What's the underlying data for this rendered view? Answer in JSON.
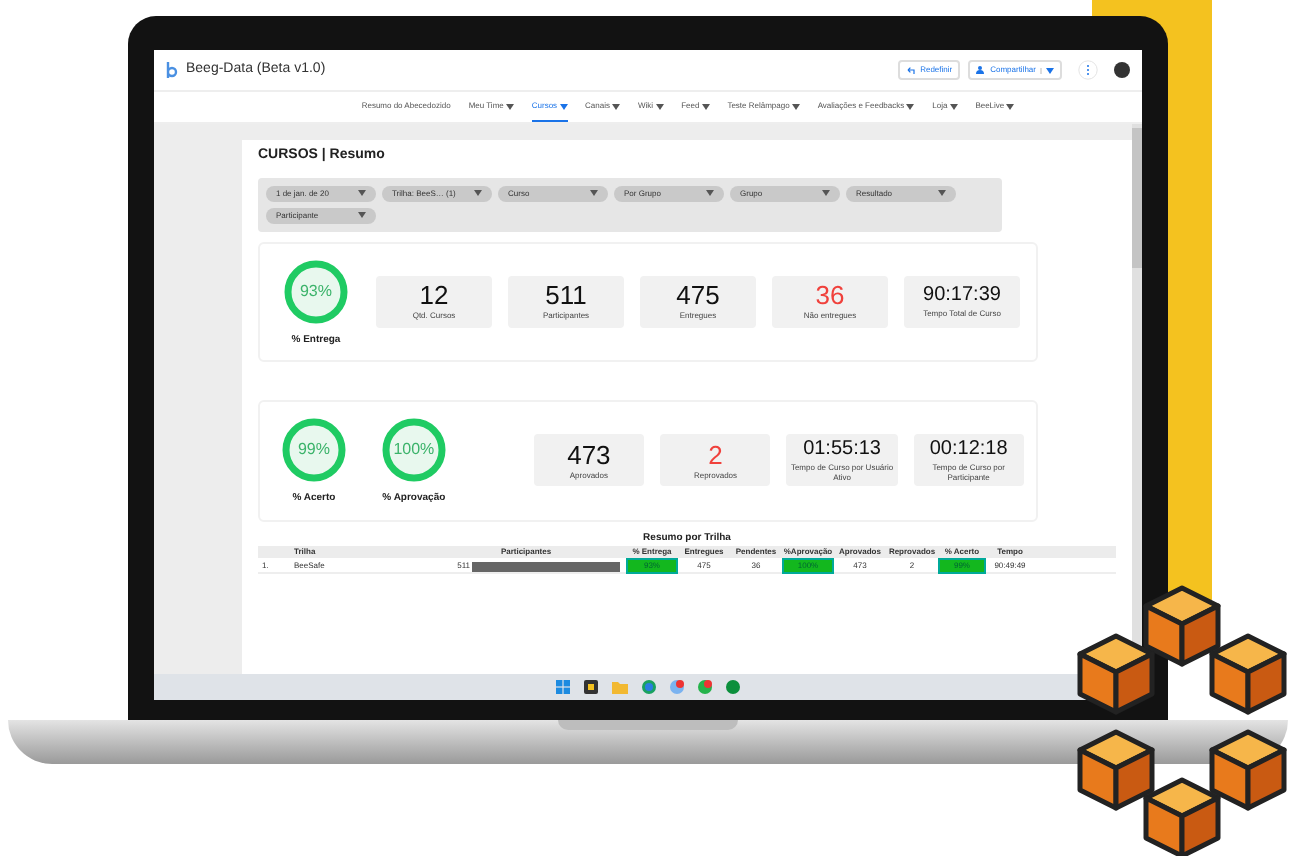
{
  "window": {
    "title": "Beeg-Data (Beta v1.0)"
  },
  "actions": [
    {
      "label": "Redefinir",
      "kind": "reset"
    },
    {
      "label": "Compartilhar",
      "kind": "share"
    }
  ],
  "nav": [
    {
      "label": "Resumo do Abecedozido",
      "selected": false,
      "menu": false
    },
    {
      "label": "Meu Time",
      "selected": false,
      "menu": true
    },
    {
      "label": "Cursos",
      "selected": true,
      "menu": true
    },
    {
      "label": "Canais",
      "selected": false,
      "menu": true
    },
    {
      "label": "Wiki",
      "selected": false,
      "menu": true
    },
    {
      "label": "Feed",
      "selected": false,
      "menu": true
    },
    {
      "label": "Teste Relâmpago",
      "selected": false,
      "menu": true
    },
    {
      "label": "Avaliações e Feedbacks",
      "selected": false,
      "menu": true
    },
    {
      "label": "Loja",
      "selected": false,
      "menu": true
    },
    {
      "label": "BeeLive",
      "selected": false,
      "menu": true
    }
  ],
  "page_title": "CURSOS | Resumo",
  "filters": [
    {
      "label": "1 de jan. de 20"
    },
    {
      "label": "Trilha:",
      "value": "BeeS…",
      "count": "(1)"
    },
    {
      "label": "Curso"
    },
    {
      "label": "Por Grupo"
    },
    {
      "label": "Grupo"
    },
    {
      "label": "Resultado"
    },
    {
      "label": "Participante"
    }
  ],
  "sections": [
    {
      "gauges": [
        {
          "value": "93%",
          "label": "% Entrega"
        }
      ],
      "stats": [
        {
          "value": "12",
          "label": "Qtd. Cursos",
          "alert": false
        },
        {
          "value": "511",
          "label": "Participantes",
          "alert": false
        },
        {
          "value": "475",
          "label": "Entregues",
          "alert": false
        },
        {
          "value": "36",
          "label": "Não entregues",
          "alert": true
        },
        {
          "value": "90:17:39",
          "label": "Tempo Total de Curso",
          "alert": false
        }
      ]
    },
    {
      "gauges": [
        {
          "value": "99%",
          "label": "% Acerto"
        },
        {
          "value": "100%",
          "label": "% Aprovação"
        }
      ],
      "stats": [
        {
          "value": "473",
          "label": "Aprovados",
          "alert": false
        },
        {
          "value": "2",
          "label": "Reprovados",
          "alert": true
        },
        {
          "value": "01:55:13",
          "label": "Tempo de Curso por Usuário Ativo",
          "alert": false
        },
        {
          "value": "00:12:18",
          "label": "Tempo de Curso por Participante",
          "alert": false
        }
      ]
    }
  ],
  "table": {
    "title": "Resumo por Trilha",
    "columns": [
      "Trilha",
      "Participantes",
      "% Entrega",
      "Entregues",
      "Pendentes",
      "%Aprovação",
      "Aprovados",
      "Reprovados",
      "% Acerto",
      "Tempo"
    ],
    "rows": [
      {
        "index": "1.",
        "trilha": "BeeSafe",
        "participantes": "511",
        "level": 1,
        "entrega": "93%",
        "entregues": "475",
        "pendentes": "36",
        "aprovacao": "100%",
        "aprovados": "473",
        "reprovados": "2",
        "acerto": "99%",
        "tempo": "90:49:49"
      }
    ]
  }
}
